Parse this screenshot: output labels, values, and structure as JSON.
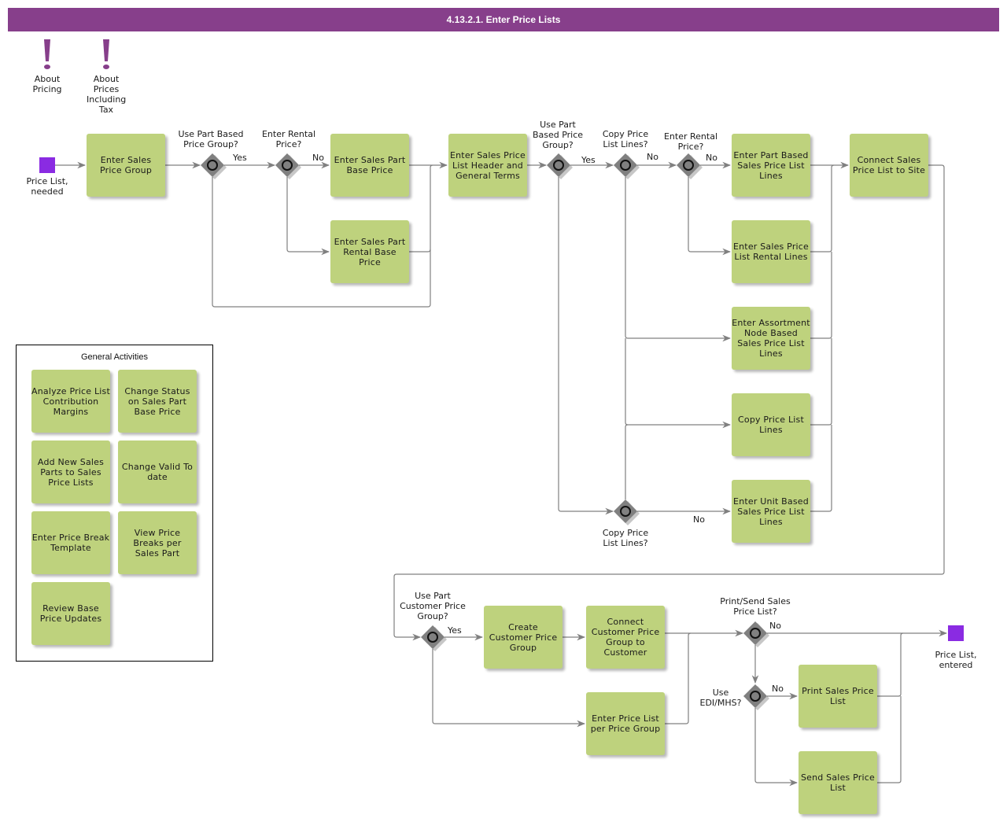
{
  "diagram": {
    "title": "4.13.2.1. Enter Price Lists",
    "colors": {
      "title_bar": "#873f8b",
      "task_fill": "#bed27d",
      "event_fill": "#8a2be2",
      "gateway_fill": "#808080",
      "connector": "#808080",
      "note_icon": "#873f8b"
    },
    "notes": [
      {
        "id": "about-pricing",
        "icon": "exclamation-icon",
        "label": "About Pricing"
      },
      {
        "id": "about-prices-including-tax",
        "icon": "exclamation-icon",
        "label": "About Prices Including Tax"
      }
    ],
    "events": {
      "start": {
        "label": "Price List, needed"
      },
      "end": {
        "label": "Price List, entered"
      }
    },
    "tasks": {
      "enter_sales_price_group": "Enter Sales Price Group",
      "enter_sales_part_base_price": "Enter Sales Part Base Price",
      "enter_sales_part_rental_base_price": "Enter Sales Part Rental Base Price",
      "enter_price_list_header": "Enter Sales Price List Header and General Terms",
      "enter_part_based_lines": "Enter Part Based Sales Price List Lines",
      "enter_rental_lines": "Enter Sales Price List Rental Lines",
      "enter_assortment_lines": "Enter Assortment Node Based Sales Price List Lines",
      "copy_price_list_lines": "Copy Price List Lines",
      "enter_unit_based_lines": "Enter Unit Based Sales Price List Lines",
      "connect_to_site": "Connect Sales Price List to Site",
      "create_customer_price_group": "Create Customer Price Group",
      "connect_group_to_customer": "Connect Customer Price Group to Customer",
      "enter_price_list_per_group": "Enter Price List per Price Group",
      "print_price_list": "Print Sales Price List",
      "send_price_list": "Send Sales Price List"
    },
    "gateways": {
      "g1": "Use Part Based Price Group?",
      "g2": "Enter Rental Price?",
      "g3": "Use Part Based Price Group?",
      "g4": "Copy Price List Lines?",
      "g5": "Enter Rental Price?",
      "g6": "Copy Price List Lines?",
      "g7": "Use Part Customer Price Group?",
      "g8": "Print/Send Sales Price List?",
      "g9": "Use EDI/MHS?"
    },
    "flow_labels": {
      "yes": "Yes",
      "no": "No"
    },
    "general_activities": {
      "title": "General Activities",
      "items": [
        "Analyze Price List Contribution Margins",
        "Change Status on Sales Part Base Price",
        "Add New Sales Parts to Sales Price Lists",
        "Change Valid To date",
        "Enter Price Break Template",
        "View Price Breaks per Sales Part",
        "Review Base Price Updates"
      ]
    }
  }
}
